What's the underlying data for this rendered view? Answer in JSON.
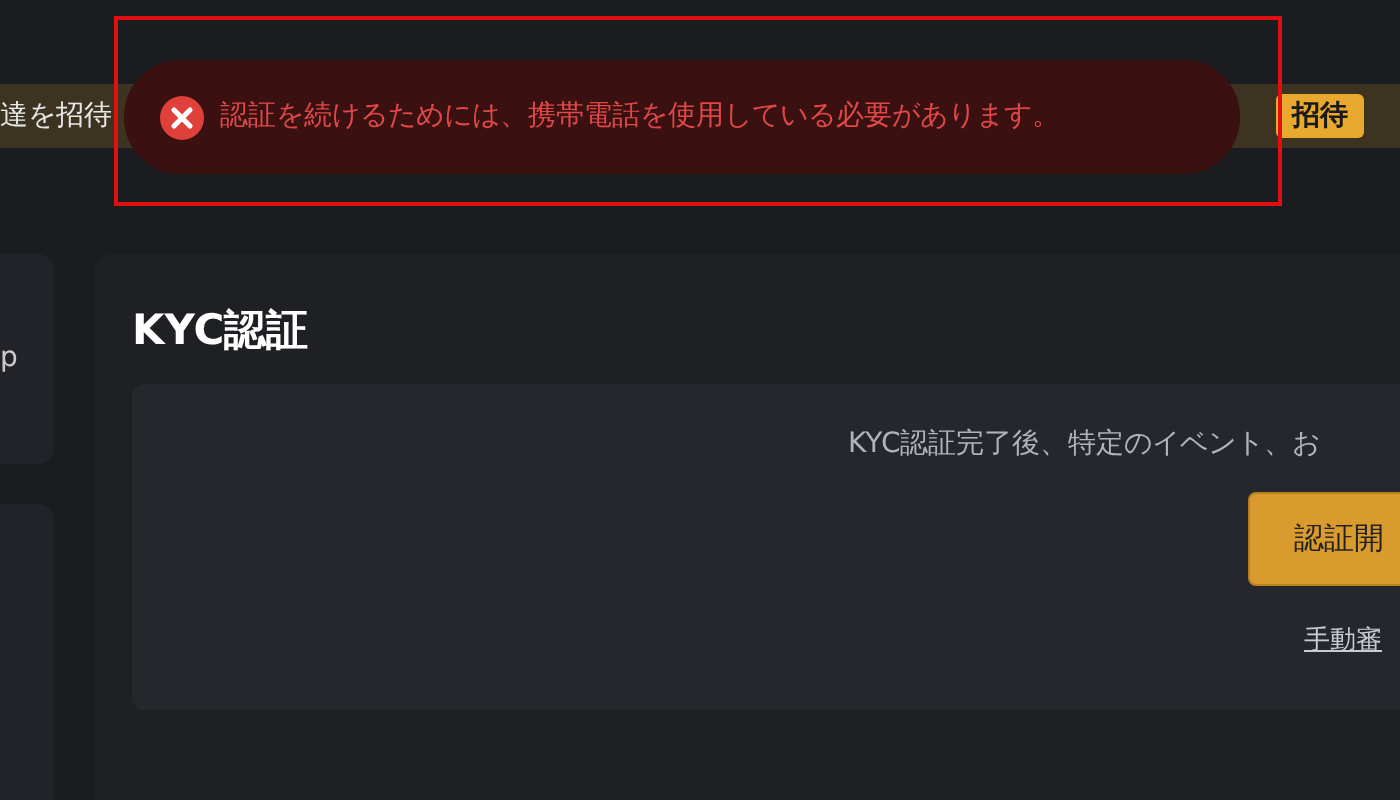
{
  "banner": {
    "text": "達を招待",
    "button": "招待"
  },
  "sidebar": {
    "text": "p"
  },
  "kyc": {
    "title": "KYC認証",
    "description": "KYC認証完了後、特定のイベント、お",
    "button": "認証開",
    "link": "手動審"
  },
  "toast": {
    "kind": "error",
    "message": "認証を続けるためには、携帯電話を使用している必要があります。"
  }
}
